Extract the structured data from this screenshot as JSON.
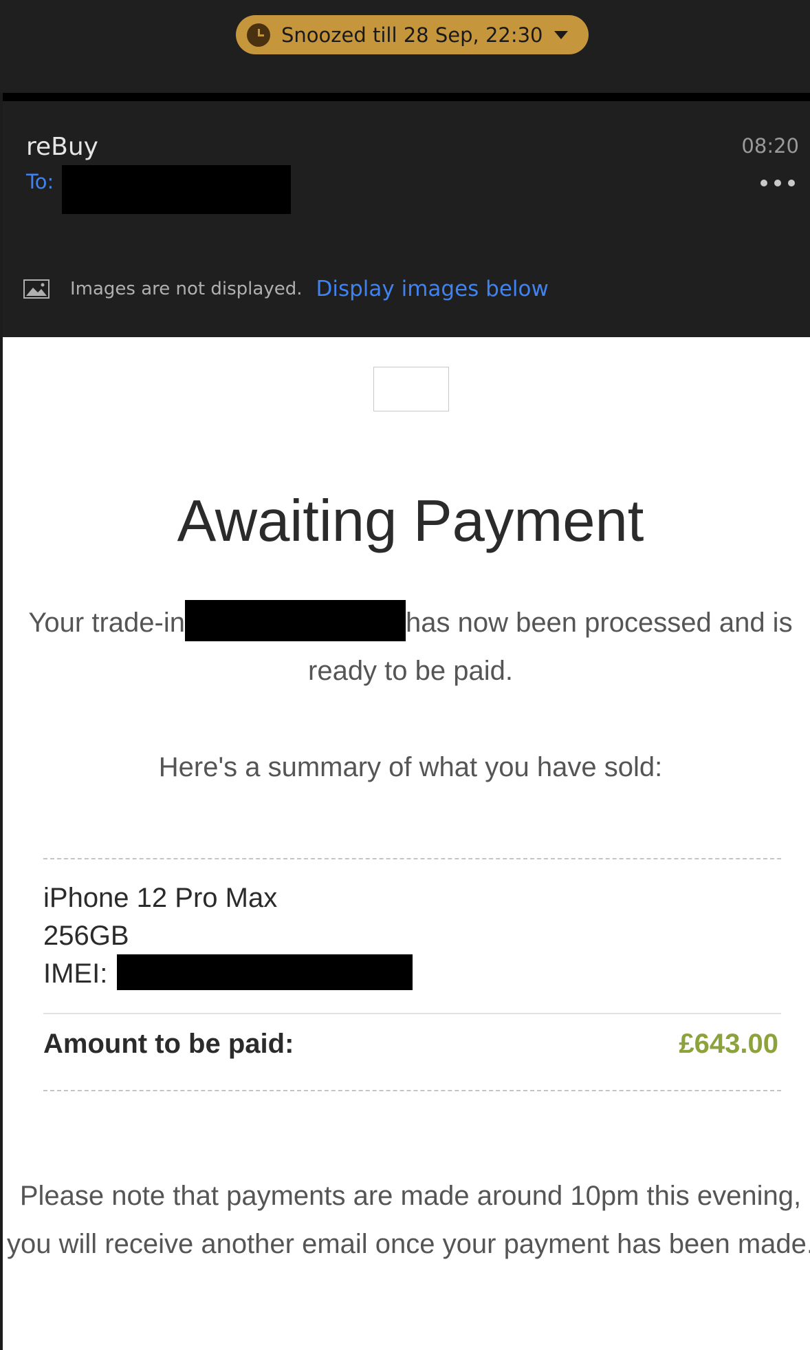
{
  "snooze": {
    "label": "Snoozed till 28 Sep, 22:30",
    "icon": "clock-icon",
    "caret_icon": "caret-down-icon",
    "color": "#c6963d"
  },
  "email": {
    "sender": "reBuy",
    "to_label": "To:",
    "time": "08:20",
    "more_icon": "more-icon"
  },
  "images_notice": {
    "icon": "image-icon",
    "text": "Images are not displayed.",
    "link": "Display images below"
  },
  "body": {
    "title": "Awaiting Payment",
    "intro_part1": "Your trade-in",
    "intro_part2": "has now been processed and is ready to be paid.",
    "summary": "Here's a summary of what you have sold:",
    "item_name": "iPhone 12 Pro Max",
    "item_capacity": "256GB",
    "imei_label": "IMEI:",
    "amount_label": "Amount to be paid:",
    "amount_value": "£643.00",
    "amount_color": "#8ca33c",
    "note": "Please note that payments are made around 10pm this evening, you will receive another email once your payment has been made."
  }
}
